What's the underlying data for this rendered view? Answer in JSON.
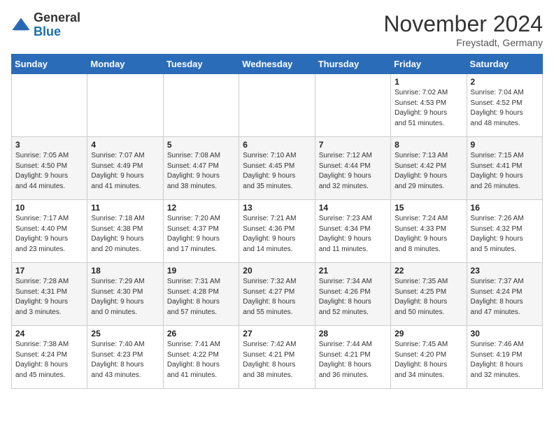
{
  "header": {
    "logo_general": "General",
    "logo_blue": "Blue",
    "month_title": "November 2024",
    "subtitle": "Freystadt, Germany"
  },
  "days_of_week": [
    "Sunday",
    "Monday",
    "Tuesday",
    "Wednesday",
    "Thursday",
    "Friday",
    "Saturday"
  ],
  "weeks": [
    [
      {
        "day": "",
        "info": ""
      },
      {
        "day": "",
        "info": ""
      },
      {
        "day": "",
        "info": ""
      },
      {
        "day": "",
        "info": ""
      },
      {
        "day": "",
        "info": ""
      },
      {
        "day": "1",
        "info": "Sunrise: 7:02 AM\nSunset: 4:53 PM\nDaylight: 9 hours\nand 51 minutes."
      },
      {
        "day": "2",
        "info": "Sunrise: 7:04 AM\nSunset: 4:52 PM\nDaylight: 9 hours\nand 48 minutes."
      }
    ],
    [
      {
        "day": "3",
        "info": "Sunrise: 7:05 AM\nSunset: 4:50 PM\nDaylight: 9 hours\nand 44 minutes."
      },
      {
        "day": "4",
        "info": "Sunrise: 7:07 AM\nSunset: 4:49 PM\nDaylight: 9 hours\nand 41 minutes."
      },
      {
        "day": "5",
        "info": "Sunrise: 7:08 AM\nSunset: 4:47 PM\nDaylight: 9 hours\nand 38 minutes."
      },
      {
        "day": "6",
        "info": "Sunrise: 7:10 AM\nSunset: 4:45 PM\nDaylight: 9 hours\nand 35 minutes."
      },
      {
        "day": "7",
        "info": "Sunrise: 7:12 AM\nSunset: 4:44 PM\nDaylight: 9 hours\nand 32 minutes."
      },
      {
        "day": "8",
        "info": "Sunrise: 7:13 AM\nSunset: 4:42 PM\nDaylight: 9 hours\nand 29 minutes."
      },
      {
        "day": "9",
        "info": "Sunrise: 7:15 AM\nSunset: 4:41 PM\nDaylight: 9 hours\nand 26 minutes."
      }
    ],
    [
      {
        "day": "10",
        "info": "Sunrise: 7:17 AM\nSunset: 4:40 PM\nDaylight: 9 hours\nand 23 minutes."
      },
      {
        "day": "11",
        "info": "Sunrise: 7:18 AM\nSunset: 4:38 PM\nDaylight: 9 hours\nand 20 minutes."
      },
      {
        "day": "12",
        "info": "Sunrise: 7:20 AM\nSunset: 4:37 PM\nDaylight: 9 hours\nand 17 minutes."
      },
      {
        "day": "13",
        "info": "Sunrise: 7:21 AM\nSunset: 4:36 PM\nDaylight: 9 hours\nand 14 minutes."
      },
      {
        "day": "14",
        "info": "Sunrise: 7:23 AM\nSunset: 4:34 PM\nDaylight: 9 hours\nand 11 minutes."
      },
      {
        "day": "15",
        "info": "Sunrise: 7:24 AM\nSunset: 4:33 PM\nDaylight: 9 hours\nand 8 minutes."
      },
      {
        "day": "16",
        "info": "Sunrise: 7:26 AM\nSunset: 4:32 PM\nDaylight: 9 hours\nand 5 minutes."
      }
    ],
    [
      {
        "day": "17",
        "info": "Sunrise: 7:28 AM\nSunset: 4:31 PM\nDaylight: 9 hours\nand 3 minutes."
      },
      {
        "day": "18",
        "info": "Sunrise: 7:29 AM\nSunset: 4:30 PM\nDaylight: 9 hours\nand 0 minutes."
      },
      {
        "day": "19",
        "info": "Sunrise: 7:31 AM\nSunset: 4:28 PM\nDaylight: 8 hours\nand 57 minutes."
      },
      {
        "day": "20",
        "info": "Sunrise: 7:32 AM\nSunset: 4:27 PM\nDaylight: 8 hours\nand 55 minutes."
      },
      {
        "day": "21",
        "info": "Sunrise: 7:34 AM\nSunset: 4:26 PM\nDaylight: 8 hours\nand 52 minutes."
      },
      {
        "day": "22",
        "info": "Sunrise: 7:35 AM\nSunset: 4:25 PM\nDaylight: 8 hours\nand 50 minutes."
      },
      {
        "day": "23",
        "info": "Sunrise: 7:37 AM\nSunset: 4:24 PM\nDaylight: 8 hours\nand 47 minutes."
      }
    ],
    [
      {
        "day": "24",
        "info": "Sunrise: 7:38 AM\nSunset: 4:24 PM\nDaylight: 8 hours\nand 45 minutes."
      },
      {
        "day": "25",
        "info": "Sunrise: 7:40 AM\nSunset: 4:23 PM\nDaylight: 8 hours\nand 43 minutes."
      },
      {
        "day": "26",
        "info": "Sunrise: 7:41 AM\nSunset: 4:22 PM\nDaylight: 8 hours\nand 41 minutes."
      },
      {
        "day": "27",
        "info": "Sunrise: 7:42 AM\nSunset: 4:21 PM\nDaylight: 8 hours\nand 38 minutes."
      },
      {
        "day": "28",
        "info": "Sunrise: 7:44 AM\nSunset: 4:21 PM\nDaylight: 8 hours\nand 36 minutes."
      },
      {
        "day": "29",
        "info": "Sunrise: 7:45 AM\nSunset: 4:20 PM\nDaylight: 8 hours\nand 34 minutes."
      },
      {
        "day": "30",
        "info": "Sunrise: 7:46 AM\nSunset: 4:19 PM\nDaylight: 8 hours\nand 32 minutes."
      }
    ]
  ]
}
